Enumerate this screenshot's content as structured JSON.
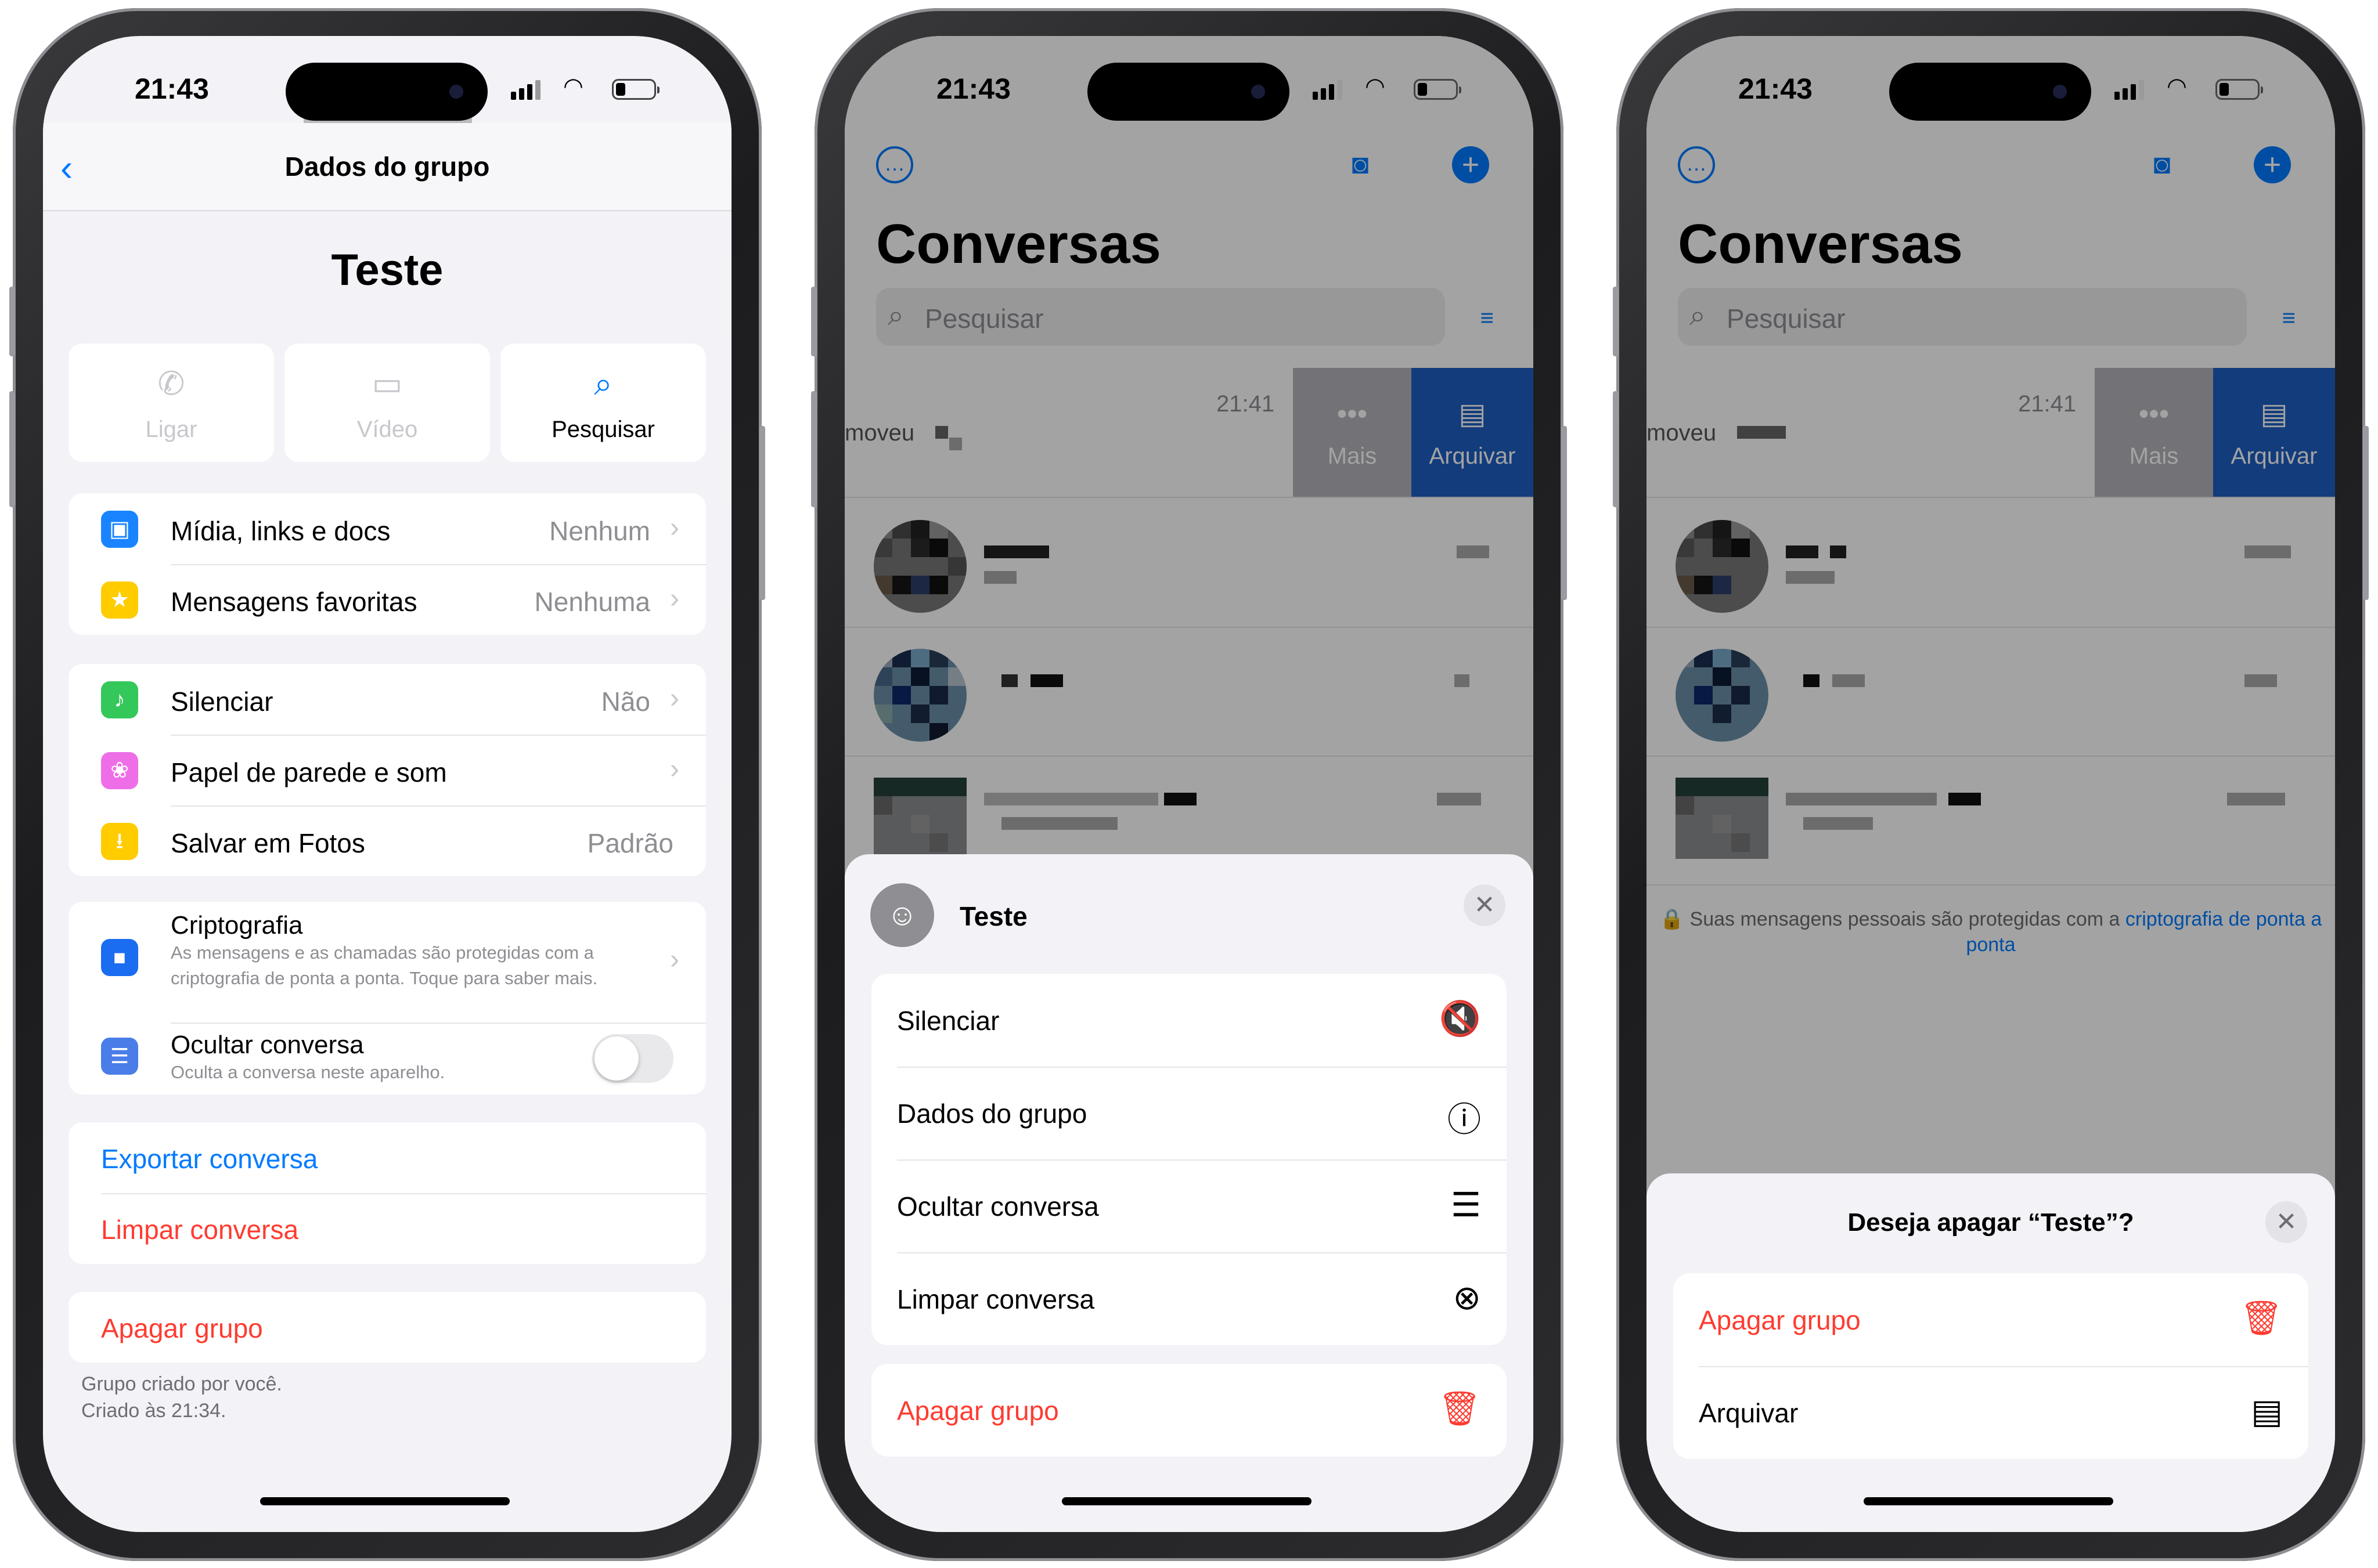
{
  "status": {
    "time": "21:43"
  },
  "phone1": {
    "nav_title": "Dados do grupo",
    "back_icon": "chevron-left-icon",
    "group_name": "Teste",
    "actions": [
      {
        "label": "Ligar",
        "icon": "phone-icon"
      },
      {
        "label": "Vídeo",
        "icon": "video-icon"
      },
      {
        "label": "Pesquisar",
        "icon": "search-icon"
      }
    ],
    "media_group": [
      {
        "label": "Mídia, links e docs",
        "value": "Nenhum",
        "icon": "photo-icon",
        "color": "#1a84ff"
      },
      {
        "label": "Mensagens favoritas",
        "value": "Nenhuma",
        "icon": "star-icon",
        "color": "#ffcc00"
      }
    ],
    "settings_group": [
      {
        "label": "Silenciar",
        "value": "Não",
        "icon": "speaker-icon",
        "color": "#34c759"
      },
      {
        "label": "Papel de parede e som",
        "value": "",
        "icon": "flower-icon",
        "color": "#ee6ee8"
      },
      {
        "label": "Salvar em Fotos",
        "value": "Padrão",
        "icon": "save-icon",
        "color": "#ffcc00"
      }
    ],
    "privacy_group": {
      "encryption_title": "Criptografia",
      "encryption_desc": "As mensagens e as chamadas são protegidas com a criptografia de ponta a ponta. Toque para saber mais.",
      "hide_title": "Ocultar conversa",
      "hide_desc": "Oculta a conversa neste aparelho.",
      "hide_enabled": false,
      "lock_color": "#1a6cf0",
      "hide_color": "#4a7de8"
    },
    "export_label": "Exportar conversa",
    "clear_label": "Limpar conversa",
    "delete_label": "Apagar grupo",
    "footer_line1": "Grupo criado por você.",
    "footer_line2": "Criado às 21:34."
  },
  "chats": {
    "title": "Conversas",
    "search_placeholder": "Pesquisar",
    "row_time": "21:41",
    "row_preview": "moveu",
    "more_label": "Mais",
    "archive_label": "Arquivar",
    "accent": "#1f5fc2"
  },
  "phone2_sheet": {
    "group_name": "Teste",
    "items": [
      {
        "label": "Silenciar",
        "icon": "mute-icon"
      },
      {
        "label": "Dados do grupo",
        "icon": "info-icon"
      },
      {
        "label": "Ocultar conversa",
        "icon": "lock-chat-icon"
      },
      {
        "label": "Limpar conversa",
        "icon": "clear-icon"
      }
    ],
    "delete_label": "Apagar grupo"
  },
  "phone3": {
    "encryption_text": "Suas mensagens pessoais são protegidas com a",
    "encryption_link": "criptografia de ponta a ponta",
    "sheet_title": "Deseja apagar “Teste”?",
    "delete_label": "Apagar grupo",
    "archive_label": "Arquivar"
  }
}
